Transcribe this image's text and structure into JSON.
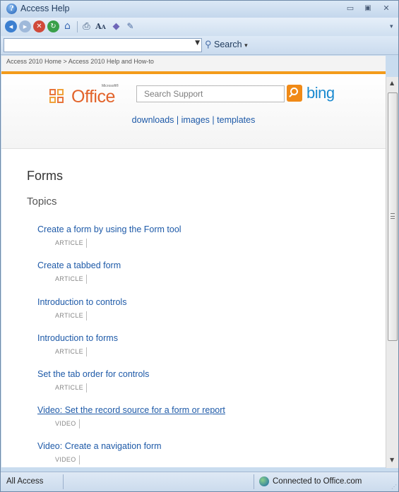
{
  "window": {
    "title": "Access Help"
  },
  "toolbar": {
    "buttons": [
      "back-icon",
      "forward-icon",
      "stop-icon",
      "refresh-icon",
      "home-icon",
      "print-icon",
      "text-size-icon",
      "table-of-contents-icon",
      "keep-on-top-icon"
    ]
  },
  "searchbar": {
    "value": "",
    "search_label": "Search"
  },
  "breadcrumb": "Access 2010 Home > Access 2010 Help and How-to",
  "header": {
    "logo_text": "Office",
    "logo_superscript": "Microsoft®",
    "support_placeholder": "Search Support",
    "bing_label": "bing",
    "links": [
      "downloads",
      "images",
      "templates"
    ]
  },
  "page": {
    "title": "Forms",
    "subtitle": "Topics",
    "topics": [
      {
        "title": "Create a form by using the Form tool",
        "kind": "ARTICLE"
      },
      {
        "title": "Create a tabbed form",
        "kind": "ARTICLE"
      },
      {
        "title": "Introduction to controls",
        "kind": "ARTICLE"
      },
      {
        "title": "Introduction to forms",
        "kind": "ARTICLE"
      },
      {
        "title": "Set the tab order for controls",
        "kind": "ARTICLE"
      },
      {
        "title": "Video: Set the record source for a form or report",
        "kind": "VIDEO"
      },
      {
        "title": "Video: Create a navigation form",
        "kind": "VIDEO"
      }
    ]
  },
  "statusbar": {
    "scope": "All Access",
    "connection": "Connected to Office.com"
  },
  "colors": {
    "link": "#1e5aa8",
    "accent_orange": "#f39b1b",
    "bing_blue": "#1a8ad0",
    "office_orange": "#e2632a"
  }
}
